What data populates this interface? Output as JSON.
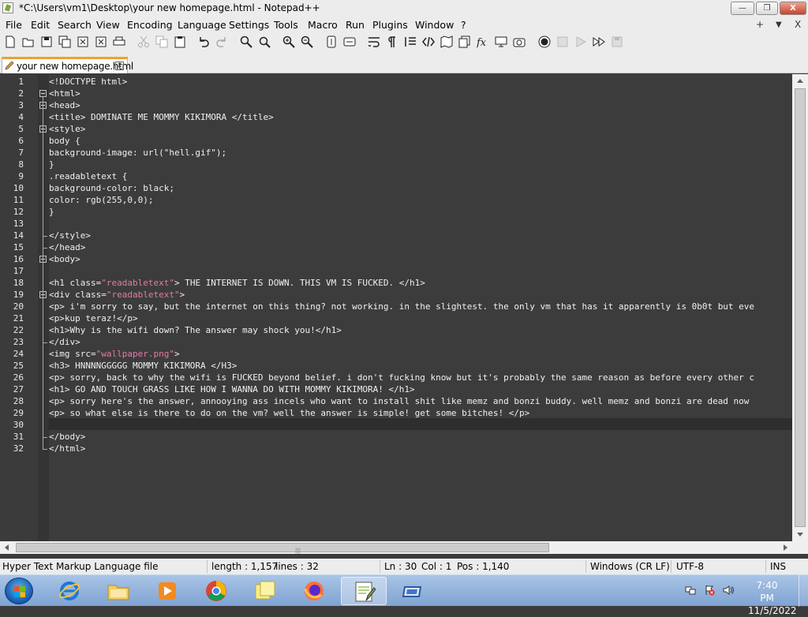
{
  "window": {
    "title": "*C:\\Users\\vm1\\Desktop\\your new homepage.html - Notepad++",
    "min_label": "—",
    "max_label": "❐",
    "close_label": "X"
  },
  "menu": {
    "items": [
      "File",
      "Edit",
      "Search",
      "View",
      "Encoding",
      "Language",
      "Settings",
      "Tools",
      "Macro",
      "Run",
      "Plugins",
      "Window",
      "?"
    ],
    "right_plus": "+",
    "right_down": "▼",
    "right_close": "X"
  },
  "toolbar": {
    "icons": [
      "new-file-icon",
      "open-file-icon",
      "save-icon",
      "save-all-icon",
      "close-icon",
      "close-all-icon",
      "print-icon",
      "cut-icon",
      "copy-icon",
      "paste-icon",
      "undo-icon",
      "redo-icon",
      "find-icon",
      "replace-icon",
      "zoom-in-icon",
      "zoom-out-icon",
      "sync-vertical-icon",
      "sync-horizontal-icon",
      "word-wrap-icon",
      "show-all-chars-icon",
      "indent-guide-icon",
      "xml-tag-icon",
      "document-map-icon",
      "folder-as-workspace-icon",
      "function-list-icon",
      "monitor-icon",
      "record-macro-icon",
      "stop-recording-icon",
      "play-macro-icon",
      "run-macro-multiple-icon",
      "save-macro-icon"
    ]
  },
  "tab": {
    "label": "your new homepage.html",
    "close": "x"
  },
  "editor": {
    "lines": [
      [
        {
          "t": "<!DOCTYPE html>"
        }
      ],
      [
        {
          "t": "<html>"
        }
      ],
      [
        {
          "t": "<head>"
        }
      ],
      [
        {
          "t": "<title> DOMINATE ME MOMMY KIKIMORA </title>"
        }
      ],
      [
        {
          "t": "<style>"
        }
      ],
      [
        {
          "t": "body {"
        }
      ],
      [
        {
          "t": "background-image: url(\"hell.gif\");"
        }
      ],
      [
        {
          "t": "}"
        }
      ],
      [
        {
          "t": ".readabletext {"
        }
      ],
      [
        {
          "t": "background-color: black;"
        }
      ],
      [
        {
          "t": "color: rgb(255,0,0);"
        }
      ],
      [
        {
          "t": "}"
        }
      ],
      [
        {
          "t": ""
        }
      ],
      [
        {
          "t": "</style>"
        }
      ],
      [
        {
          "t": "</head>"
        }
      ],
      [
        {
          "t": "<body>"
        }
      ],
      [
        {
          "t": ""
        }
      ],
      [
        {
          "t": "<h1 class="
        },
        {
          "t": "\"readabletext\"",
          "c": "str"
        },
        {
          "t": "> THE INTERNET IS DOWN. THIS VM IS FUCKED. </h1>"
        }
      ],
      [
        {
          "t": "<div class="
        },
        {
          "t": "\"readabletext\"",
          "c": "str"
        },
        {
          "t": ">"
        }
      ],
      [
        {
          "t": "<p> i'm sorry to say, but the internet on this thing? not working. in the slightest. the only vm that has it apparently is 0b0t but eve"
        }
      ],
      [
        {
          "t": "<p>kup teraz!</p>"
        }
      ],
      [
        {
          "t": "<h1>Why is the wifi down? The answer may shock you!</h1>"
        }
      ],
      [
        {
          "t": "</div>"
        }
      ],
      [
        {
          "t": "<img src="
        },
        {
          "t": "\"wallpaper.png\"",
          "c": "str"
        },
        {
          "t": ">"
        }
      ],
      [
        {
          "t": "<h3> HNNNNGGGGG MOMMY KIKIMORA </H3>"
        }
      ],
      [
        {
          "t": "<p> sorry, back to why the wifi is FUCKED beyond belief. i don't fucking know but it's probably the same reason as before every other c"
        }
      ],
      [
        {
          "t": "<h1> GO AND TOUCH GRASS LIKE HOW I WANNA DO WITH MOMMY KIKIMORA! </h1>"
        }
      ],
      [
        {
          "t": "<p> sorry here's the answer, annooying ass incels who want to install shit like memz and bonzi buddy. well memz and bonzi are dead now"
        }
      ],
      [
        {
          "t": "<p> so what else is there to do on the vm? well the answer is simple! get some bitches! </p>"
        }
      ],
      [
        {
          "t": ""
        }
      ],
      [
        {
          "t": "</body>"
        }
      ],
      [
        {
          "t": "</html>"
        }
      ]
    ],
    "current_line": 30
  },
  "status": {
    "filetype": "Hyper Text Markup Language file",
    "length": "length : 1,157",
    "lines": "lines : 32",
    "ln": "Ln : 30",
    "col": "Col : 1",
    "pos": "Pos : 1,140",
    "eol": "Windows (CR LF)",
    "encoding": "UTF-8",
    "mode": "INS"
  },
  "taskbar": {
    "apps": [
      "internet-explorer-icon",
      "explorer-folder-icon",
      "media-player-icon",
      "chrome-icon",
      "sticky-notes-icon",
      "firefox-icon",
      "notepad-plus-plus-icon",
      "virtual-drive-icon"
    ],
    "active_app": "notepad-plus-plus-icon",
    "time": "7:40 PM",
    "date": "11/5/2022"
  }
}
